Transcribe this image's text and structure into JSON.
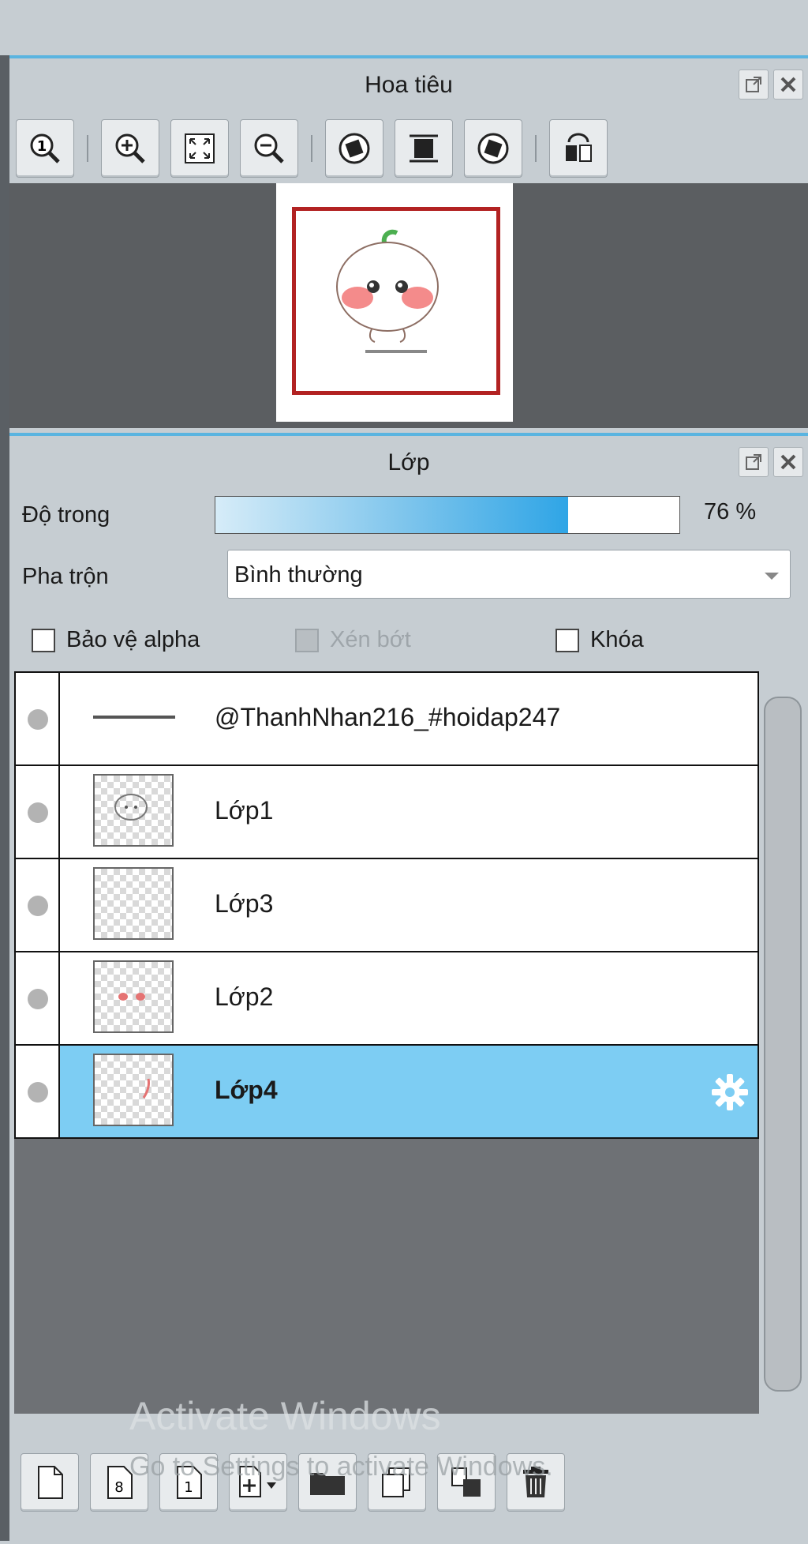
{
  "navigator": {
    "title": "Hoa tiêu",
    "toolbar": [
      {
        "icon": "zoom-actual-icon"
      },
      {
        "icon": "zoom-in-icon"
      },
      {
        "icon": "fit-window-icon"
      },
      {
        "icon": "zoom-out-icon"
      },
      {
        "icon": "rotate-left-icon"
      },
      {
        "icon": "reset-view-icon"
      },
      {
        "icon": "rotate-right-icon"
      },
      {
        "icon": "flip-horizontal-icon"
      }
    ],
    "preview_caption": ""
  },
  "layers_panel": {
    "title": "Lớp",
    "opacity_label": "Độ trong",
    "opacity_value": 76,
    "opacity_text": "76 %",
    "blend_label": "Pha trộn",
    "blend_value": "Bình thường",
    "protect_alpha_label": "Bảo vệ alpha",
    "clipping_label": "Xén bớt",
    "lock_label": "Khóa",
    "layers": [
      {
        "name": "@ThanhNhan216_#hoidap247",
        "type": "text",
        "selected": false
      },
      {
        "name": "Lớp1",
        "type": "raster",
        "selected": false
      },
      {
        "name": "Lớp3",
        "type": "raster",
        "selected": false
      },
      {
        "name": "Lớp2",
        "type": "raster",
        "selected": false
      },
      {
        "name": "Lớp4",
        "type": "raster",
        "selected": true
      }
    ]
  },
  "bottom_toolbar": [
    {
      "icon": "new-layer-icon"
    },
    {
      "icon": "new-8bit-layer-icon"
    },
    {
      "icon": "new-1bit-layer-icon"
    },
    {
      "icon": "add-layer-dropdown-icon"
    },
    {
      "icon": "new-folder-icon"
    },
    {
      "icon": "duplicate-layer-icon"
    },
    {
      "icon": "merge-down-icon"
    },
    {
      "icon": "delete-layer-icon"
    }
  ],
  "watermark": {
    "line1": "Activate Windows",
    "line2": "Go to Settings to activate Windows."
  },
  "colors": {
    "accent": "#5ab4e0",
    "selected_row": "#7dcdf3",
    "panel_bg": "#c6cdd2",
    "canvas_bg": "#5b5e61",
    "frame": "#b22222"
  }
}
